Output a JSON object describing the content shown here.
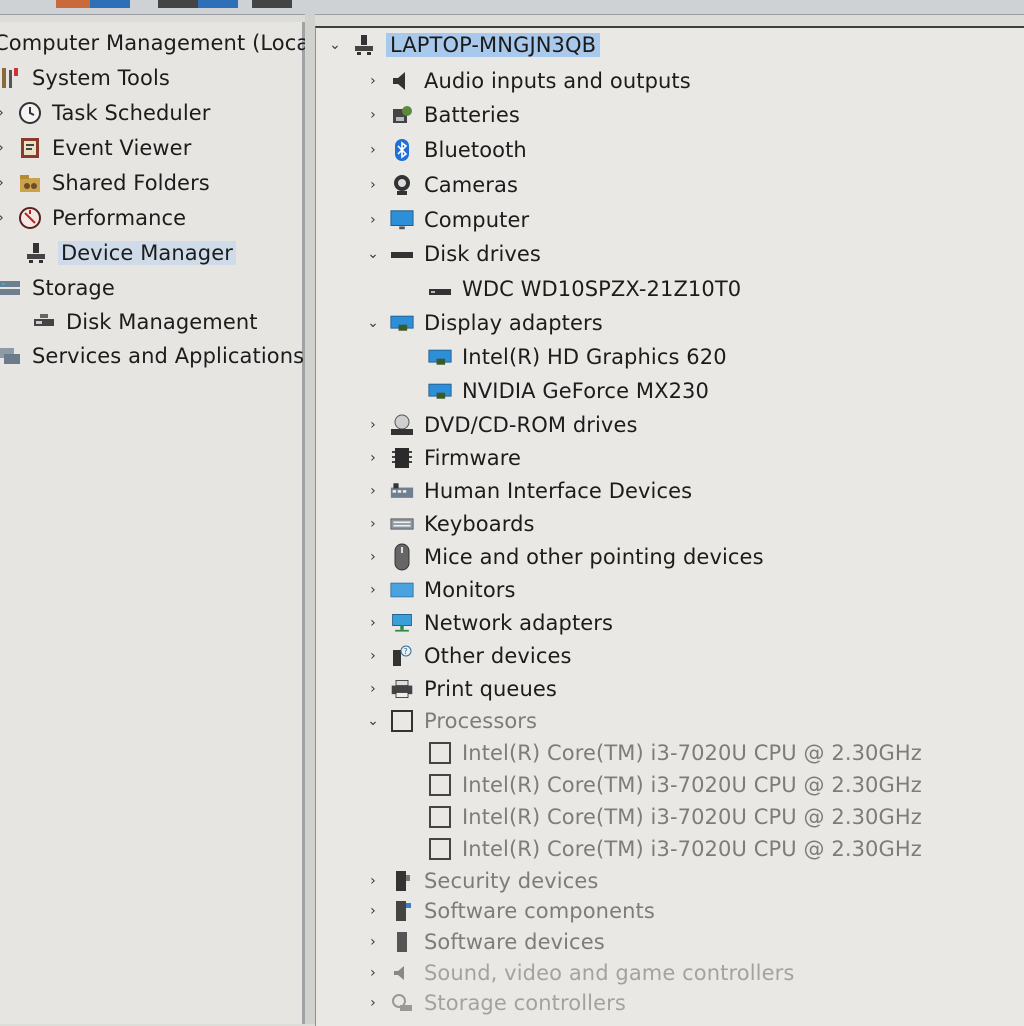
{
  "left_tree": {
    "root": "Computer Management (Local",
    "items": [
      {
        "label": "System Tools"
      },
      {
        "label": "Task Scheduler"
      },
      {
        "label": "Event Viewer"
      },
      {
        "label": "Shared Folders"
      },
      {
        "label": "Performance"
      },
      {
        "label": "Device Manager"
      },
      {
        "label": "Storage"
      },
      {
        "label": "Disk Management"
      },
      {
        "label": "Services and Applications"
      }
    ]
  },
  "device_tree": {
    "computer_name": "LAPTOP-MNGJN3QB",
    "items": [
      {
        "label": "Audio inputs and outputs",
        "icon": "speaker-icon"
      },
      {
        "label": "Batteries",
        "icon": "battery-icon"
      },
      {
        "label": "Bluetooth",
        "icon": "bluetooth-icon"
      },
      {
        "label": "Cameras",
        "icon": "camera-icon"
      },
      {
        "label": "Computer",
        "icon": "monitor-icon"
      },
      {
        "label": "Disk drives",
        "icon": "disk-drive-icon",
        "expanded": true
      },
      {
        "label": "WDC WD10SPZX-21Z10T0",
        "icon": "disk-drive-icon"
      },
      {
        "label": "Display adapters",
        "icon": "display-adapter-icon",
        "expanded": true
      },
      {
        "label": "Intel(R) HD Graphics 620",
        "icon": "display-adapter-icon"
      },
      {
        "label": "NVIDIA GeForce MX230",
        "icon": "display-adapter-icon"
      },
      {
        "label": "DVD/CD-ROM drives",
        "icon": "dvd-drive-icon"
      },
      {
        "label": "Firmware",
        "icon": "firmware-icon"
      },
      {
        "label": "Human Interface Devices",
        "icon": "hid-icon"
      },
      {
        "label": "Keyboards",
        "icon": "keyboard-icon"
      },
      {
        "label": "Mice and other pointing devices",
        "icon": "mouse-icon"
      },
      {
        "label": "Monitors",
        "icon": "monitor-icon"
      },
      {
        "label": "Network adapters",
        "icon": "network-adapter-icon"
      },
      {
        "label": "Other devices",
        "icon": "other-devices-icon"
      },
      {
        "label": "Print queues",
        "icon": "printer-icon"
      },
      {
        "label": "Processors",
        "icon": "processor-icon",
        "expanded": true
      },
      {
        "label": "Intel(R) Core(TM) i3-7020U CPU @ 2.30GHz",
        "icon": "processor-icon"
      },
      {
        "label": "Intel(R) Core(TM) i3-7020U CPU @ 2.30GHz",
        "icon": "processor-icon"
      },
      {
        "label": "Intel(R) Core(TM) i3-7020U CPU @ 2.30GHz",
        "icon": "processor-icon"
      },
      {
        "label": "Intel(R) Core(TM) i3-7020U CPU @ 2.30GHz",
        "icon": "processor-icon"
      },
      {
        "label": "Security devices",
        "icon": "security-device-icon"
      },
      {
        "label": "Software components",
        "icon": "software-component-icon"
      },
      {
        "label": "Software devices",
        "icon": "software-device-icon"
      },
      {
        "label": "Sound, video and game controllers",
        "icon": "sound-controller-icon"
      },
      {
        "label": "Storage controllers",
        "icon": "storage-controller-icon"
      }
    ]
  },
  "colors": {
    "selection_highlight": "#a9c9ec",
    "inactive_selection": "#cfdbe8",
    "bluetooth_blue": "#1f6fd6",
    "monitor_blue": "#2d8fd8"
  }
}
